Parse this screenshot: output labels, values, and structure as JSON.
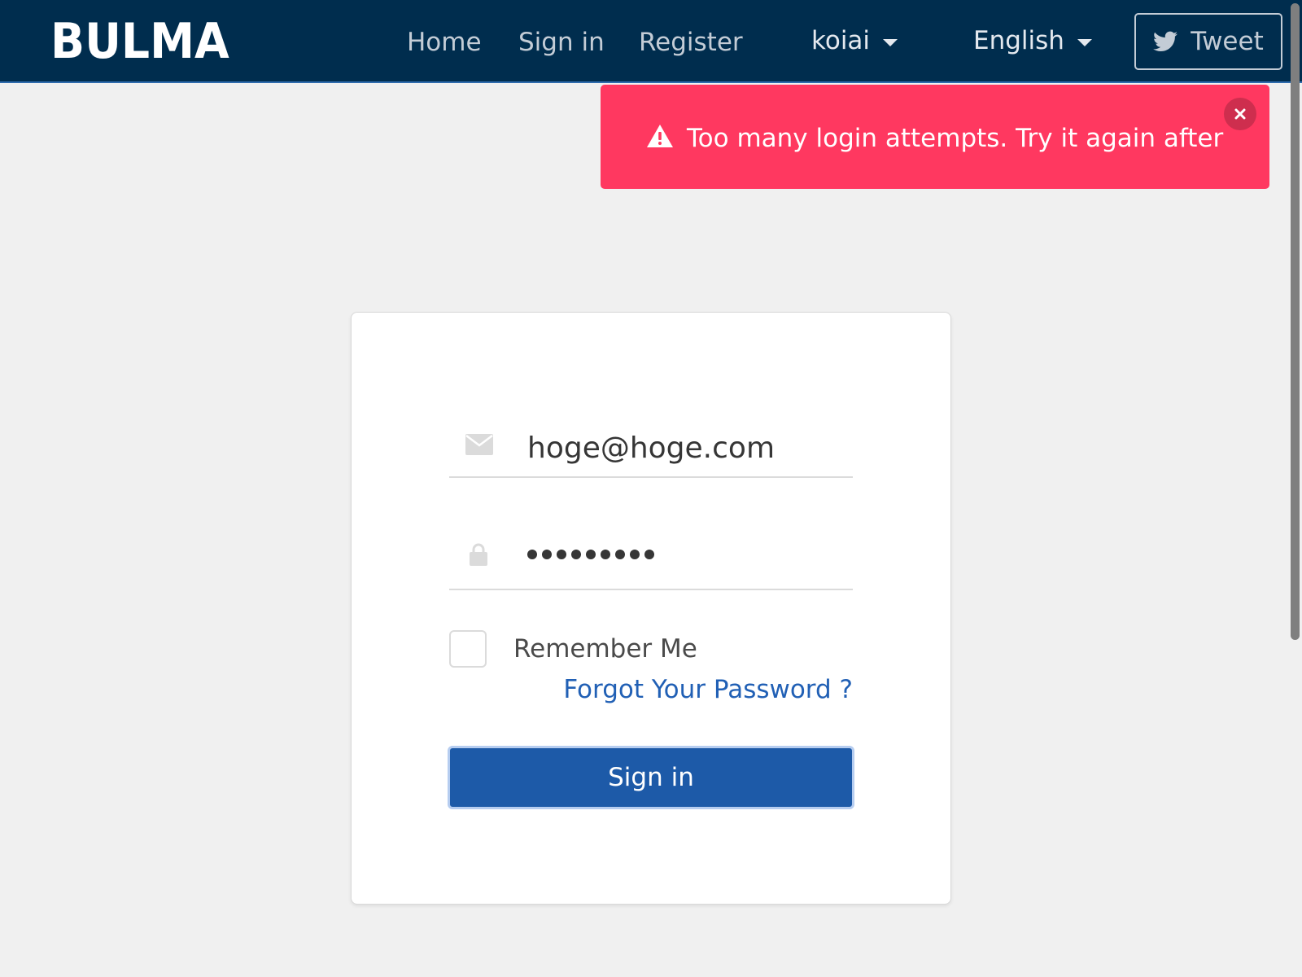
{
  "navbar": {
    "brand": "BULMA",
    "links": {
      "home": "Home",
      "sign_in": "Sign in",
      "register": "Register"
    },
    "user_menu": "koiai",
    "language_menu": "English",
    "tweet_label": "Tweet",
    "background_color": "#002d4e"
  },
  "alert": {
    "message": "Too many login attempts. Try it again after",
    "icon": "warning-icon",
    "close_icon": "close-icon",
    "color": "#ff3860"
  },
  "login_form": {
    "email": {
      "icon": "envelope-icon",
      "value": "hoge@hoge.com"
    },
    "password": {
      "icon": "lock-icon",
      "masked_length": 9
    },
    "remember_label": "Remember Me",
    "remember_checked": false,
    "forgot_link": "Forgot Your Password ?",
    "submit_label": "Sign in",
    "accent_color": "#1d5aa8",
    "link_color": "#2160b5"
  }
}
